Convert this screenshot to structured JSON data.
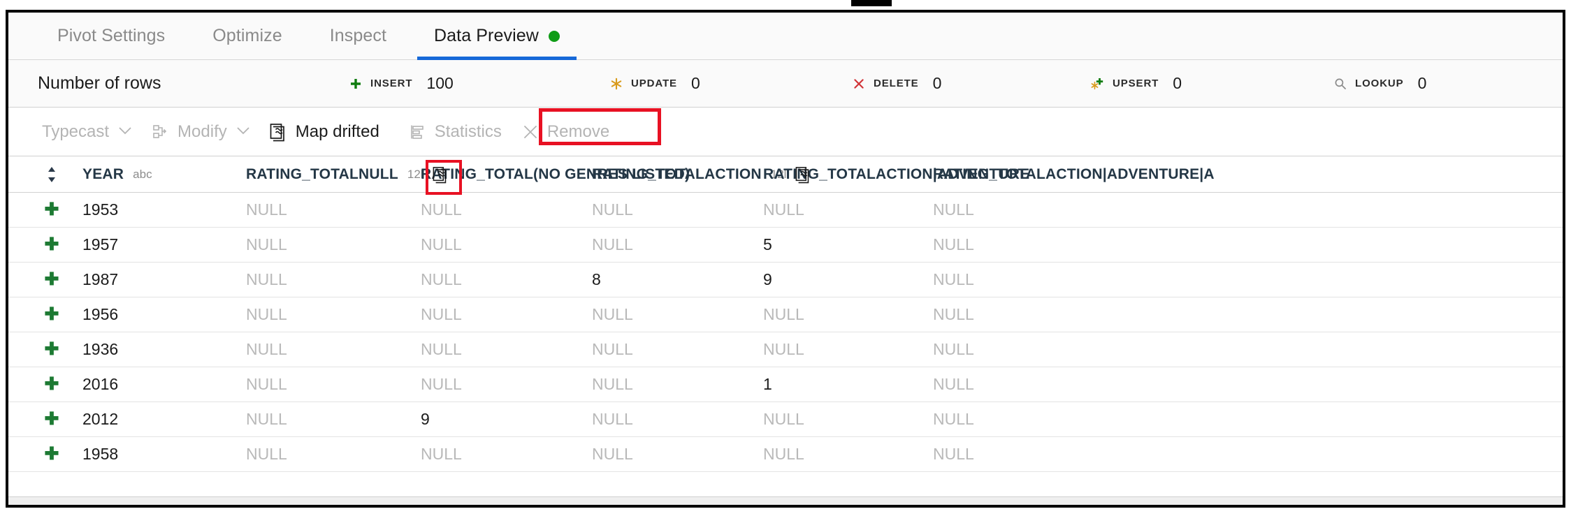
{
  "window": {
    "handle_label": "window-drag-handle"
  },
  "tabs": [
    {
      "label": "Pivot Settings",
      "active": false,
      "dot": false
    },
    {
      "label": "Optimize",
      "active": false,
      "dot": false
    },
    {
      "label": "Inspect",
      "active": false,
      "dot": false
    },
    {
      "label": "Data Preview",
      "active": true,
      "dot": true
    }
  ],
  "stats": {
    "rows_label": "Number of rows",
    "items": [
      {
        "icon": "plus-icon",
        "label": "INSERT",
        "value": "100",
        "color": "#107c10"
      },
      {
        "icon": "asterisk-icon",
        "label": "UPDATE",
        "value": "0",
        "color": "#d99b1c"
      },
      {
        "icon": "x-icon",
        "label": "DELETE",
        "value": "0",
        "color": "#d13438"
      },
      {
        "icon": "upsert-icon",
        "label": "UPSERT",
        "value": "0",
        "color": "#107c10"
      },
      {
        "icon": "search-icon",
        "label": "LOOKUP",
        "value": "0",
        "color": "#8a8a8a"
      }
    ]
  },
  "toolbar": {
    "typecast_label": "Typecast",
    "modify_label": "Modify",
    "map_drifted_label": "Map drifted",
    "statistics_label": "Statistics",
    "remove_label": "Remove",
    "caret": "⌄",
    "highlight_color": "#e81123"
  },
  "grid": {
    "columns": [
      {
        "name": "YEAR",
        "type": "abc",
        "drift": false
      },
      {
        "name": "RATING_TOTALNULL",
        "type": "12l",
        "drift": true,
        "drift_highlight": true
      },
      {
        "name": "RATING_TOTAL(NO GENRES LISTED)",
        "type": "",
        "drift": false
      },
      {
        "name": "RATING_TOTALACTION",
        "type": "12l",
        "drift": true,
        "drift_highlight": false
      },
      {
        "name": "RATING_TOTALACTION|ADVENTURE",
        "type": "",
        "drift": false
      },
      {
        "name": "RATING_TOTALACTION|ADVENTURE|A",
        "type": "",
        "drift": false
      }
    ],
    "null_text": "NULL",
    "add_glyph": "✚",
    "rows": [
      {
        "year": "1953",
        "cells": [
          "NULL",
          "NULL",
          "NULL",
          "NULL",
          "NULL"
        ]
      },
      {
        "year": "1957",
        "cells": [
          "NULL",
          "NULL",
          "NULL",
          "5",
          "NULL"
        ]
      },
      {
        "year": "1987",
        "cells": [
          "NULL",
          "NULL",
          "8",
          "9",
          "NULL"
        ]
      },
      {
        "year": "1956",
        "cells": [
          "NULL",
          "NULL",
          "NULL",
          "NULL",
          "NULL"
        ]
      },
      {
        "year": "1936",
        "cells": [
          "NULL",
          "NULL",
          "NULL",
          "NULL",
          "NULL"
        ]
      },
      {
        "year": "2016",
        "cells": [
          "NULL",
          "NULL",
          "NULL",
          "1",
          "NULL"
        ]
      },
      {
        "year": "2012",
        "cells": [
          "NULL",
          "9",
          "NULL",
          "NULL",
          "NULL"
        ]
      },
      {
        "year": "1958",
        "cells": [
          "NULL",
          "NULL",
          "NULL",
          "NULL",
          "NULL"
        ]
      }
    ]
  }
}
